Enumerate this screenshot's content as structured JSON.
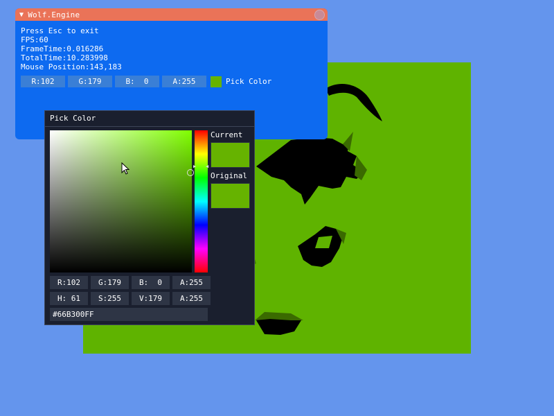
{
  "window": {
    "title": "Wolf.Engine",
    "collapse_icon": "triangle-down-icon",
    "close_icon": "close-circle-icon"
  },
  "stats": {
    "line1": "Press Esc to exit",
    "fps": "FPS:60",
    "frame_time": "FrameTime:0.016286",
    "total_time": "TotalTime:10.283998",
    "mouse_position": "Mouse Position:143,183"
  },
  "color_edit": {
    "r": "R:102",
    "g": "G:179",
    "b": "B:  0",
    "a": "A:255",
    "label": "Pick Color",
    "swatch_color": "#66B300"
  },
  "picker": {
    "title": "Pick Color",
    "current_label": "Current",
    "original_label": "Original",
    "rgb": [
      "R:102",
      "G:179",
      "B:  0",
      "A:255"
    ],
    "hsv": [
      "H: 61",
      "S:255",
      "V:179",
      "A:255"
    ],
    "hex": "#66B300FF",
    "hue_color": "#80FF00"
  },
  "colors": {
    "background": "#6495ED",
    "scene": "#5FB300",
    "window_title_bar": "#EA7358",
    "window_body": "#0D6AF0"
  }
}
